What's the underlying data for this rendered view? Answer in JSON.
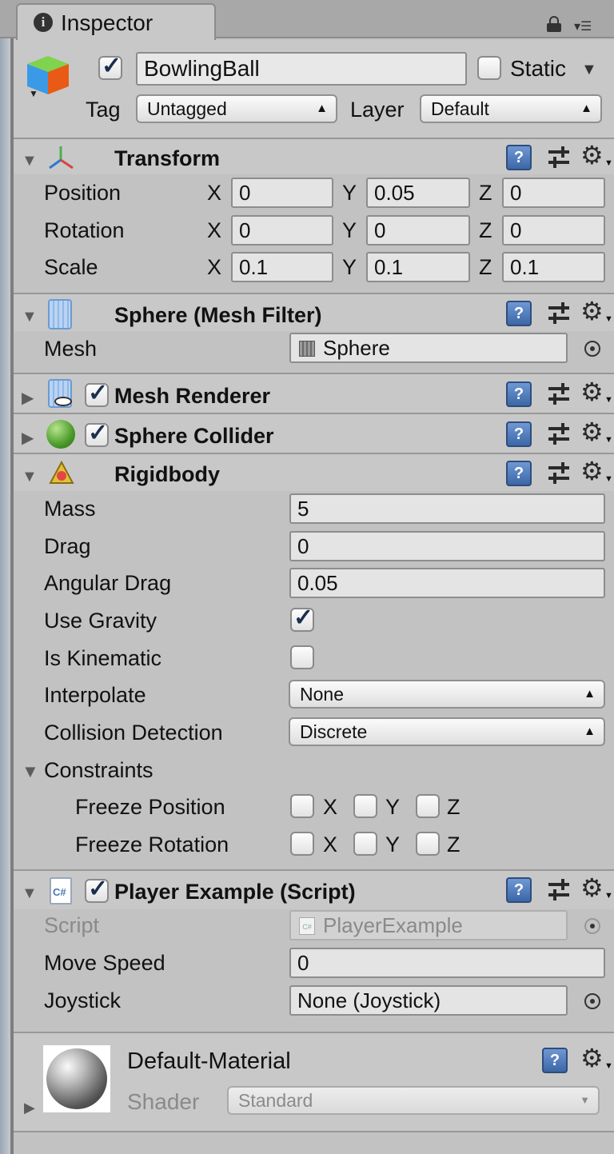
{
  "tab": {
    "title": "Inspector"
  },
  "object": {
    "name": "BowlingBall",
    "active": true,
    "static_label": "Static",
    "static_checked": false,
    "tag_label": "Tag",
    "tag_value": "Untagged",
    "layer_label": "Layer",
    "layer_value": "Default"
  },
  "transform": {
    "title": "Transform",
    "position": {
      "label": "Position",
      "x": "0",
      "y": "0.05",
      "z": "0"
    },
    "rotation": {
      "label": "Rotation",
      "x": "0",
      "y": "0",
      "z": "0"
    },
    "scale": {
      "label": "Scale",
      "x": "0.1",
      "y": "0.1",
      "z": "0.1"
    },
    "axis": {
      "x": "X",
      "y": "Y",
      "z": "Z"
    }
  },
  "mesh_filter": {
    "title": "Sphere (Mesh Filter)",
    "mesh_label": "Mesh",
    "mesh_value": "Sphere"
  },
  "mesh_renderer": {
    "title": "Mesh Renderer",
    "enabled": true
  },
  "sphere_collider": {
    "title": "Sphere Collider",
    "enabled": true
  },
  "rigidbody": {
    "title": "Rigidbody",
    "mass_label": "Mass",
    "mass": "5",
    "drag_label": "Drag",
    "drag": "0",
    "angular_drag_label": "Angular Drag",
    "angular_drag": "0.05",
    "use_gravity_label": "Use Gravity",
    "use_gravity": true,
    "is_kinematic_label": "Is Kinematic",
    "is_kinematic": false,
    "interpolate_label": "Interpolate",
    "interpolate": "None",
    "collision_label": "Collision Detection",
    "collision": "Discrete",
    "constraints_label": "Constraints",
    "freeze_position_label": "Freeze Position",
    "freeze_rotation_label": "Freeze Rotation"
  },
  "script": {
    "title": "Player Example (Script)",
    "enabled": true,
    "script_label": "Script",
    "script_value": "PlayerExample",
    "cs_badge": "C#",
    "move_speed_label": "Move Speed",
    "move_speed": "0",
    "joystick_label": "Joystick",
    "joystick": "None (Joystick)"
  },
  "material": {
    "name": "Default-Material",
    "shader_label": "Shader",
    "shader_value": "Standard"
  },
  "help_glyph": "?",
  "colors": {
    "panel": "#c2c2c2",
    "header": "#c8c8c8",
    "field": "#e4e4e4",
    "help": "#3c67a6"
  }
}
